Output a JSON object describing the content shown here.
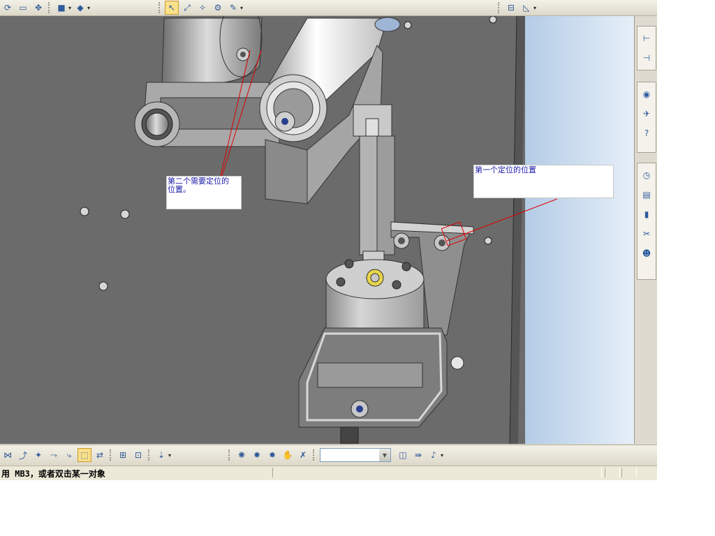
{
  "toolbar_top": {
    "groups": [
      {
        "buttons": [
          "rotate-icon",
          "zoom-window-icon",
          "pan-icon",
          "cube-view-icon",
          "shade-icon"
        ]
      },
      {
        "buttons": [
          "select-icon",
          "transform-icon",
          "snap-icon",
          "analyze-icon",
          "measure-icon"
        ]
      },
      {
        "buttons": [
          "section-icon",
          "display-icon"
        ]
      }
    ]
  },
  "annotations": [
    {
      "id": "note-second",
      "text": "第二个需要定位的\n位置。"
    },
    {
      "id": "note-first",
      "text": "第一个定位的位置"
    }
  ],
  "resource_bar": {
    "items": [
      "assembly-navigator-icon",
      "constraint-navigator-icon",
      "web-browser-icon",
      "history-palette-icon",
      "help-icon",
      "clock-icon",
      "part-list-icon",
      "color-roles-icon",
      "tools-icon",
      "user-roles-icon"
    ]
  },
  "toolbar_bottom": {
    "combo_value": ""
  },
  "status_bar": {
    "prompt": "用 MB3，或者双击某一对象"
  },
  "colors": {
    "viewport_bg": "#6b6b6b",
    "leader_line": "#e00000",
    "note_text": "#1a1aa8",
    "sky_gradient": "#c7dcef"
  }
}
